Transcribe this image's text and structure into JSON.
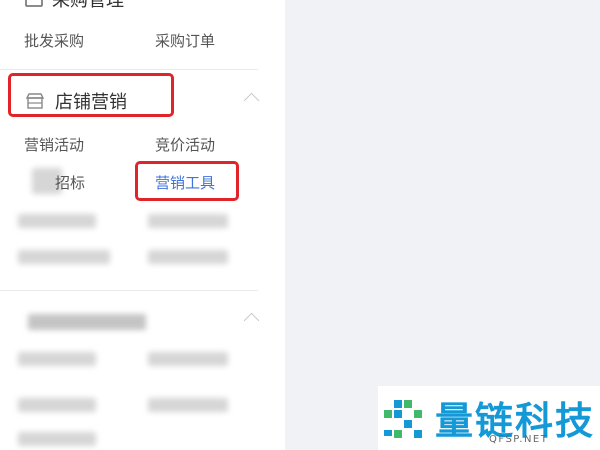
{
  "sidebar": {
    "section_top": {
      "title": "采购管理",
      "items": [
        "批发采购",
        "采购订单"
      ]
    },
    "section_store_marketing": {
      "title": "店铺营销",
      "icon": "shop-icon",
      "items": [
        "营销活动",
        "竞价活动",
        "招标",
        "营销工具"
      ]
    }
  },
  "watermark": {
    "title": "量链科技",
    "subtitle": "QFSP.NET",
    "color": "#1599d6"
  },
  "highlight_color": "#e0242a",
  "active_color": "#3f73d8"
}
